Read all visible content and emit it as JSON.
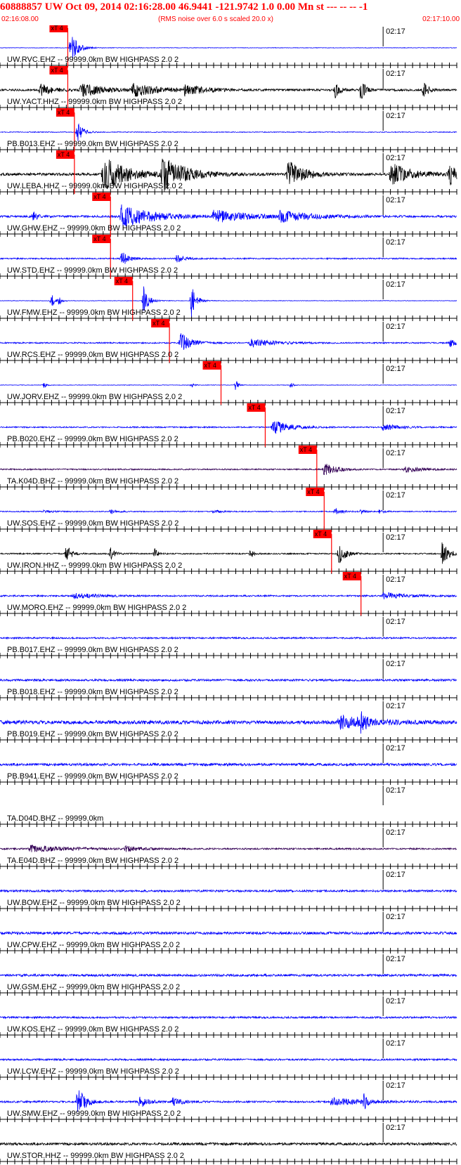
{
  "header": {
    "title": "60888857 UW Oct 09, 2014 02:16:28.00   46.9441 -121.9742  1.0 0.00 Mn st --- -- --  -1",
    "start_time": "02:16:08.00",
    "rms_note": "(RMS noise over 6.0 s scaled 20.0 x)",
    "end_time": "02:17:10.00"
  },
  "colors": {
    "blue": "#0000ff",
    "black": "#000000",
    "purple": "#330055",
    "red": "#ff0000",
    "axis": "#000000"
  },
  "chart_data": {
    "type": "seismogram",
    "x_range_seconds": [
      0,
      62
    ],
    "minute_label": "02:17",
    "minute_tick_seconds": 52,
    "pick_label": "xT 4",
    "traces": [
      {
        "label": "UW.RVC.EHZ -- 99999.0km BW  HIGHPASS  2.0  2",
        "color": "blue",
        "pick_s": 9.2,
        "noise": 0.02,
        "bursts": [
          [
            9.5,
            3,
            1.4,
            0.9
          ]
        ]
      },
      {
        "label": "UW.YACT.HHZ -- 99999.0km BW  HIGHPASS  2.0  2",
        "color": "black",
        "pick_s": 9.2,
        "noise": 0.08,
        "bursts": [
          [
            5.5,
            4,
            0.5,
            1.5
          ],
          [
            11,
            5,
            0.6,
            2.5
          ],
          [
            18,
            6,
            0.55,
            3
          ],
          [
            25,
            4,
            0.45,
            2.5
          ],
          [
            45.5,
            1,
            0.6,
            0.6
          ],
          [
            49,
            1,
            0.8,
            0.6
          ],
          [
            57.5,
            1,
            0.7,
            0.6
          ]
        ]
      },
      {
        "label": "PB.B013.EHZ -- 99999.0km BW  HIGHPASS  2.0  2",
        "color": "blue",
        "pick_s": 10.1,
        "noise": 0.03,
        "bursts": [
          [
            10.5,
            2.5,
            0.8,
            0.7
          ]
        ]
      },
      {
        "label": "UW.LEBA.HHZ -- 99999.0km BW  HIGHPASS  2.0  2",
        "color": "black",
        "pick_s": 10.1,
        "noise": 0.1,
        "bursts": [
          [
            14,
            5,
            1.4,
            3
          ],
          [
            22,
            6,
            1.4,
            3
          ],
          [
            39,
            4,
            1.1,
            2
          ],
          [
            53,
            5,
            0.9,
            2.5
          ],
          [
            61,
            2,
            0.9,
            1
          ]
        ]
      },
      {
        "label": "UW.GHW.EHZ -- 99999.0km BW  HIGHPASS  2.0  2",
        "color": "blue",
        "pick_s": 15,
        "noise": 0.08,
        "bursts": [
          [
            4.5,
            1,
            0.4,
            0.5
          ],
          [
            16.5,
            9,
            0.9,
            4
          ],
          [
            29,
            7,
            0.5,
            4
          ],
          [
            38,
            6,
            0.4,
            4
          ]
        ]
      },
      {
        "label": "UW.STD.EHZ -- 99999.0km BW  HIGHPASS  2.0  2",
        "color": "blue",
        "pick_s": 15,
        "noise": 0.05,
        "bursts": [
          [
            16.5,
            2,
            0.6,
            1
          ],
          [
            24,
            2,
            0.3,
            1
          ]
        ]
      },
      {
        "label": "UW.FMW.EHZ -- 99999.0km BW  HIGHPASS  2.0  2",
        "color": "blue",
        "pick_s": 18,
        "noise": 0.02,
        "bursts": [
          [
            7,
            1.2,
            0.6,
            0.4
          ],
          [
            8,
            0.8,
            0.4,
            0.3
          ],
          [
            19.5,
            2,
            1.2,
            0.6
          ],
          [
            26,
            2,
            1.3,
            0.6
          ]
        ]
      },
      {
        "label": "UW.RCS.EHZ -- 99999.0km BW  HIGHPASS  2.0  2",
        "color": "blue",
        "pick_s": 23,
        "noise": 0.05,
        "bursts": [
          [
            24.5,
            3,
            0.8,
            1.5
          ],
          [
            34,
            4,
            0.35,
            3
          ],
          [
            61,
            1.5,
            0.4,
            0.6
          ]
        ]
      },
      {
        "label": "UW.JORV.EHZ -- 99999.0km BW  HIGHPASS  2.0  2",
        "color": "blue",
        "pick_s": 30,
        "noise": 0.02,
        "bursts": [
          [
            6,
            0.6,
            0.25,
            0.3
          ],
          [
            26,
            0.5,
            0.2,
            0.3
          ],
          [
            32,
            0.6,
            0.5,
            0.3
          ],
          [
            39.5,
            0.6,
            0.25,
            0.3
          ]
        ]
      },
      {
        "label": "PB.B020.EHZ -- 99999.0km BW  HIGHPASS  2.0  2",
        "color": "blue",
        "pick_s": 36,
        "noise": 0.05,
        "bursts": [
          [
            37,
            4,
            0.6,
            2
          ],
          [
            52,
            3,
            0.25,
            2
          ]
        ]
      },
      {
        "label": "TA.K04D.BHZ -- 99999.0km BW  HIGHPASS  2.0  2",
        "color": "purple",
        "pick_s": 43,
        "noise": 0.05,
        "bursts": [
          [
            44,
            3,
            0.5,
            1.5
          ],
          [
            55,
            3,
            0.25,
            2
          ]
        ]
      },
      {
        "label": "UW.SOS.EHZ -- 99999.0km BW  HIGHPASS  2.0  2",
        "color": "blue",
        "pick_s": 44,
        "noise": 0.04,
        "bursts": [
          [
            6,
            2,
            0.15,
            1
          ],
          [
            15,
            1.5,
            0.15,
            1
          ],
          [
            29,
            1.5,
            0.15,
            1
          ],
          [
            45.5,
            2,
            0.25,
            1
          ],
          [
            49,
            1,
            0.15,
            0.6
          ],
          [
            51.5,
            1,
            0.15,
            0.6
          ]
        ]
      },
      {
        "label": "UW.IRON.HHZ -- 99999.0km BW  HIGHPASS  2.0  2",
        "color": "black",
        "pick_s": 45,
        "noise": 0.05,
        "bursts": [
          [
            9,
            1.5,
            0.8,
            0.6
          ],
          [
            15,
            1,
            0.5,
            0.5
          ],
          [
            21,
            1,
            0.4,
            0.4
          ],
          [
            34,
            1,
            0.35,
            0.4
          ],
          [
            46,
            2,
            0.9,
            0.8
          ],
          [
            60,
            2.5,
            1.1,
            0.8
          ]
        ]
      },
      {
        "label": "UW.MORO.EHZ -- 99999.0km BW  HIGHPASS  2.0  2",
        "color": "blue",
        "pick_s": 49,
        "noise": 0.06,
        "bursts": [
          [
            10,
            4,
            0.2,
            3
          ],
          [
            52,
            4,
            0.25,
            3
          ]
        ]
      },
      {
        "label": "PB.B017.EHZ -- 99999.0km BW  HIGHPASS  2.0  2",
        "color": "blue",
        "noise": 0.06,
        "bursts": []
      },
      {
        "label": "PB.B018.EHZ -- 99999.0km BW  HIGHPASS  2.0  2",
        "color": "blue",
        "noise": 0.08,
        "bursts": []
      },
      {
        "label": "PB.B019.EHZ -- 99999.0km BW  HIGHPASS  2.0  2",
        "color": "blue",
        "noise": 0.14,
        "bursts": [
          [
            46,
            7,
            0.5,
            4
          ],
          [
            49,
            1.5,
            0.7,
            0.6
          ]
        ]
      },
      {
        "label": "PB.B941.EHZ -- 99999.0km BW  HIGHPASS  2.0  2",
        "color": "blue",
        "noise": 0.1,
        "bursts": []
      },
      {
        "label": "TA.D04D.BHZ -- 99999.0km",
        "color": "blue",
        "noise": 0,
        "bursts": []
      },
      {
        "label": "TA.E04D.BHZ -- 99999.0km BW  HIGHPASS  2.0  2",
        "color": "purple",
        "noise": 0.06,
        "bursts": [
          [
            4,
            8,
            0.25,
            5
          ],
          [
            17,
            3,
            0.2,
            2
          ]
        ]
      },
      {
        "label": "UW.BOW.EHZ -- 99999.0km BW  HIGHPASS  2.0  2",
        "color": "blue",
        "noise": 0.08,
        "bursts": []
      },
      {
        "label": "UW.CPW.EHZ -- 99999.0km BW  HIGHPASS  2.0  2",
        "color": "blue",
        "noise": 0.1,
        "bursts": []
      },
      {
        "label": "UW.GSM.EHZ -- 99999.0km BW  HIGHPASS  2.0  2",
        "color": "blue",
        "noise": 0.09,
        "bursts": []
      },
      {
        "label": "UW.KOS.EHZ -- 99999.0km BW  HIGHPASS  2.0  2",
        "color": "blue",
        "noise": 0.07,
        "bursts": []
      },
      {
        "label": "UW.LCW.EHZ -- 99999.0km BW  HIGHPASS  2.0  2",
        "color": "blue",
        "noise": 0.07,
        "bursts": []
      },
      {
        "label": "UW.SMW.EHZ -- 99999.0km BW  HIGHPASS  2.0  2",
        "color": "blue",
        "noise": 0.07,
        "bursts": [
          [
            10.5,
            3,
            1.2,
            1
          ],
          [
            19,
            2,
            0.5,
            1
          ],
          [
            23.5,
            2,
            0.4,
            1
          ],
          [
            45,
            6,
            0.3,
            4
          ],
          [
            49.5,
            0.5,
            0.9,
            0.3
          ]
        ]
      },
      {
        "label": "UW.STOR.HHZ -- 99999.0km BW  HIGHPASS  2.0  2",
        "color": "black",
        "noise": 0.1,
        "bursts": []
      }
    ]
  }
}
